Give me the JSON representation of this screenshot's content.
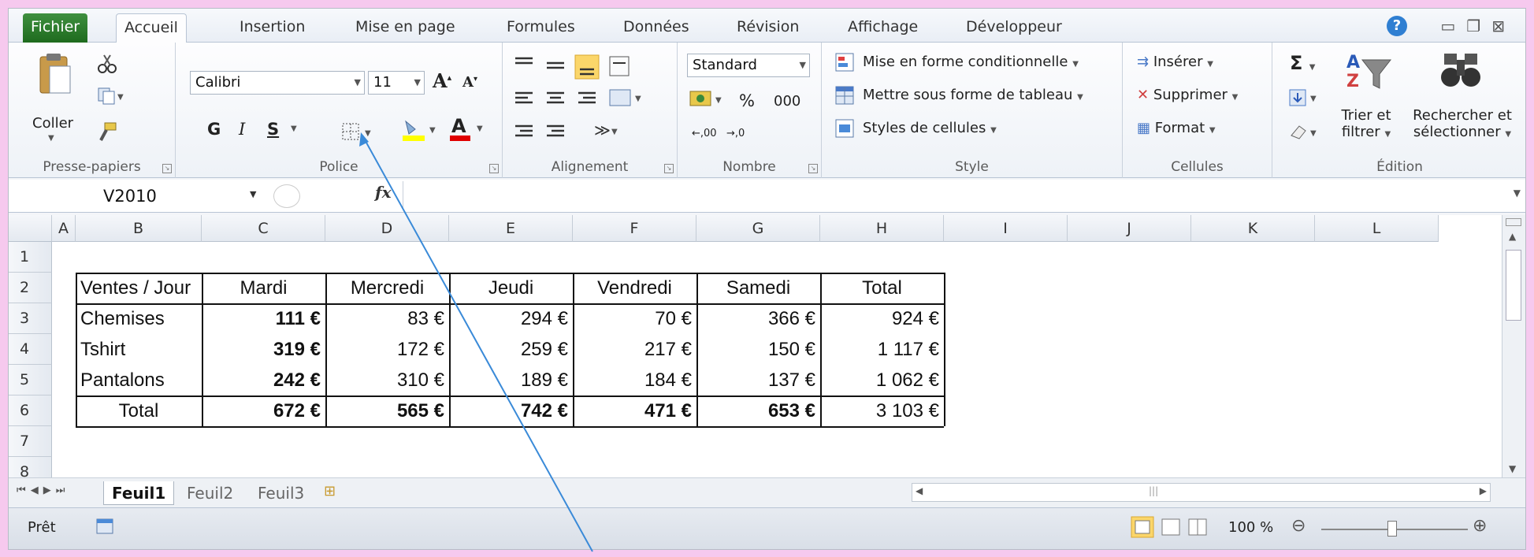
{
  "tabs": [
    {
      "label": "Fichier"
    },
    {
      "label": "Accueil"
    },
    {
      "label": "Insertion"
    },
    {
      "label": "Mise en page"
    },
    {
      "label": "Formules"
    },
    {
      "label": "Données"
    },
    {
      "label": "Révision"
    },
    {
      "label": "Affichage"
    },
    {
      "label": "Développeur"
    }
  ],
  "ribbon": {
    "clipboard": {
      "paste": "Coller",
      "label": "Presse-papiers"
    },
    "font": {
      "name": "Calibri",
      "size": "11",
      "bold": "G",
      "italic": "I",
      "underline": "S",
      "grow": "A",
      "shrink": "A",
      "label": "Police"
    },
    "alignment": {
      "label": "Alignement"
    },
    "number": {
      "format": "Standard",
      "percent": "%",
      "thousands": "000",
      "inc_decimals": ",00",
      "dec_decimals": ",0",
      "label": "Nombre"
    },
    "style": {
      "conditional": "Mise en forme conditionnelle",
      "table": "Mettre sous forme de tableau",
      "cell_styles": "Styles de cellules",
      "label": "Style"
    },
    "cells": {
      "insert": "Insérer",
      "delete": "Supprimer",
      "format": "Format",
      "label": "Cellules"
    },
    "editing": {
      "sum": "Σ",
      "sort1": "Trier et",
      "sort2": "filtrer",
      "find1": "Rechercher et",
      "find2": "sélectionner",
      "label": "Édition"
    }
  },
  "formula_bar": {
    "name_box": "V2010",
    "fx": "fx",
    "value": ""
  },
  "columns": [
    "A",
    "B",
    "C",
    "D",
    "E",
    "F",
    "G",
    "H",
    "I",
    "J",
    "K",
    "L"
  ],
  "rows": [
    "1",
    "2",
    "3",
    "4",
    "5",
    "6",
    "7",
    "8"
  ],
  "table": {
    "headers": [
      "Ventes / Jour",
      "Mardi",
      "Mercredi",
      "Jeudi",
      "Vendredi",
      "Samedi",
      "Total"
    ],
    "rows": [
      [
        "Chemises",
        "111 €",
        "83 €",
        "294 €",
        "70 €",
        "366 €",
        "924 €"
      ],
      [
        "Tshirt",
        "319 €",
        "172 €",
        "259 €",
        "217 €",
        "150 €",
        "1 117 €"
      ],
      [
        "Pantalons",
        "242 €",
        "310 €",
        "189 €",
        "184 €",
        "137 €",
        "1 062 €"
      ],
      [
        "Total",
        "672 €",
        "565 €",
        "742 €",
        "471 €",
        "653 €",
        "3 103 €"
      ]
    ]
  },
  "sheets": [
    {
      "label": "Feuil1"
    },
    {
      "label": "Feuil2"
    },
    {
      "label": "Feuil3"
    }
  ],
  "status": {
    "ready": "Prêt",
    "zoom": "100 %"
  },
  "colors": {
    "file_tab": "#2a7a2a",
    "accent": "#2f7fd2",
    "arrow": "#3a8ad8"
  }
}
